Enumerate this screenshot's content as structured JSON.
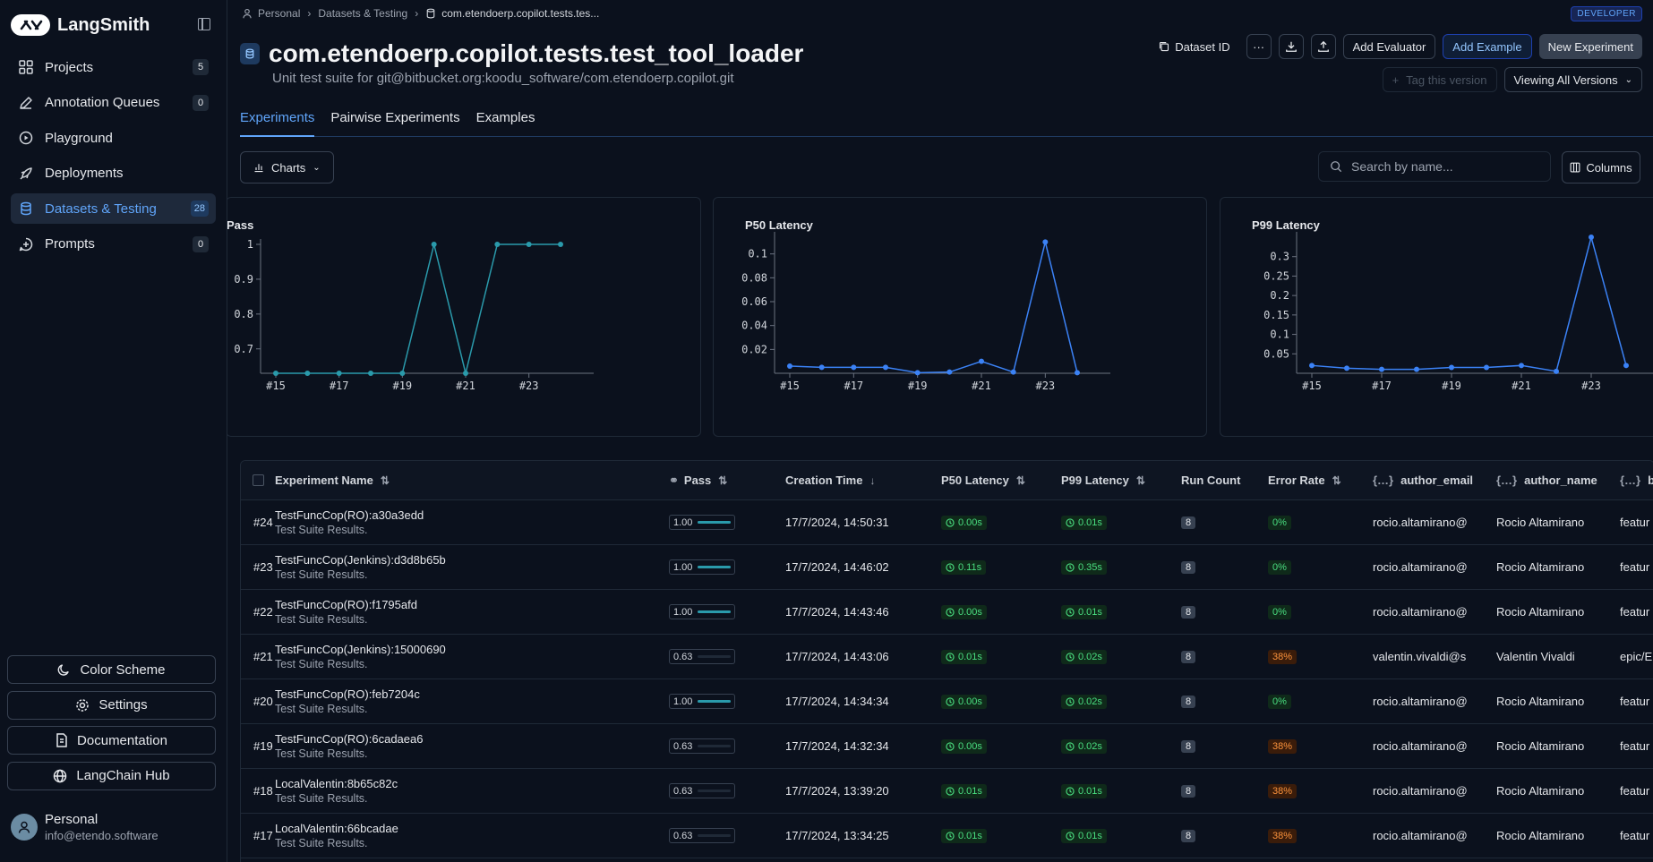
{
  "sidebar": {
    "brand": "LangSmith",
    "items": [
      {
        "label": "Projects",
        "count": "5",
        "icon": "grid-icon"
      },
      {
        "label": "Annotation Queues",
        "count": "0",
        "icon": "pen-icon"
      },
      {
        "label": "Playground",
        "count": "",
        "icon": "play-icon"
      },
      {
        "label": "Deployments",
        "count": "",
        "icon": "rocket-icon"
      },
      {
        "label": "Datasets & Testing",
        "count": "28",
        "icon": "database-icon",
        "active": true
      },
      {
        "label": "Prompts",
        "count": "0",
        "icon": "prompt-icon"
      }
    ],
    "bottom": {
      "color_scheme": "Color Scheme",
      "settings": "Settings",
      "documentation": "Documentation",
      "hub": "LangChain Hub"
    },
    "user": {
      "name": "Personal",
      "email": "info@etendo.software"
    }
  },
  "breadcrumb": {
    "root": "Personal",
    "section": "Datasets & Testing",
    "current": "com.etendoerp.copilot.tests.tes..."
  },
  "dev_badge": "DEVELOPER",
  "header": {
    "title": "com.etendoerp.copilot.tests.test_tool_loader",
    "subtitle": "Unit test suite for git@bitbucket.org:koodu_software/com.etendoerp.copilot.git",
    "dataset_id": "Dataset ID",
    "more": "···",
    "add_evaluator": "Add Evaluator",
    "add_example": "Add Example",
    "new_experiment": "New Experiment",
    "tag_version": "Tag this version",
    "viewing": "Viewing All Versions"
  },
  "tabs": [
    "Experiments",
    "Pairwise Experiments",
    "Examples"
  ],
  "toolbar": {
    "charts": "Charts",
    "search_placeholder": "Search by name...",
    "columns": "Columns"
  },
  "chart_data": [
    {
      "type": "line",
      "title": "Pass",
      "x": [
        "#15",
        "#16",
        "#17",
        "#18",
        "#19",
        "#20",
        "#21",
        "#22",
        "#23",
        "#24"
      ],
      "values": [
        0.63,
        0.63,
        0.63,
        0.63,
        0.63,
        1.0,
        0.63,
        1.0,
        1.0,
        1.0
      ],
      "yticks": [
        "1",
        "0.9",
        "0.8",
        "0.7"
      ],
      "xticks": [
        "#15",
        "#17",
        "#19",
        "#21",
        "#23"
      ],
      "ylim": [
        0.63,
        1.0
      ],
      "color": "#2a9aab"
    },
    {
      "type": "line",
      "title": "P50 Latency",
      "x": [
        "#15",
        "#16",
        "#17",
        "#18",
        "#19",
        "#20",
        "#21",
        "#22",
        "#23",
        "#24"
      ],
      "values": [
        0.006,
        0.005,
        0.005,
        0.005,
        0.0005,
        0.001,
        0.01,
        0.001,
        0.11,
        0.0005
      ],
      "yticks": [
        "0.1",
        "0.08",
        "0.06",
        "0.04",
        "0.02"
      ],
      "xticks": [
        "#15",
        "#17",
        "#19",
        "#21",
        "#23"
      ],
      "ylim": [
        0,
        0.114
      ],
      "color": "#3b82f6"
    },
    {
      "type": "line",
      "title": "P99 Latency",
      "x": [
        "#15",
        "#16",
        "#17",
        "#18",
        "#19",
        "#20",
        "#21",
        "#22",
        "#23",
        "#24"
      ],
      "values": [
        0.02,
        0.013,
        0.01,
        0.01,
        0.015,
        0.015,
        0.02,
        0.005,
        0.35,
        0.02
      ],
      "yticks": [
        "0.3",
        "0.25",
        "0.2",
        "0.15",
        "0.1",
        "0.05"
      ],
      "xticks": [
        "#15",
        "#17",
        "#19",
        "#21",
        "#23"
      ],
      "ylim": [
        0,
        0.35
      ],
      "color": "#3b82f6"
    }
  ],
  "table": {
    "headers": {
      "name": "Experiment Name",
      "pass": "Pass",
      "time": "Creation Time",
      "p50": "P50 Latency",
      "p99": "P99 Latency",
      "run": "Run Count",
      "err": "Error Rate",
      "mail": "author_email",
      "auth": "author_name",
      "b": "b"
    },
    "rows": [
      {
        "num": "#24",
        "name": "TestFuncCop(RO):a30a3edd",
        "desc": "Test Suite Results.",
        "pass": "1.00",
        "pass_frac": 1.0,
        "time": "17/7/2024, 14:50:31",
        "p50": "0.00s",
        "p99": "0.01s",
        "run": "8",
        "err": "0%",
        "err_bad": false,
        "mail": "rocio.altamirano@",
        "auth": "Rocio Altamirano",
        "b": "featur"
      },
      {
        "num": "#23",
        "name": "TestFuncCop(Jenkins):d3d8b65b",
        "desc": "Test Suite Results.",
        "pass": "1.00",
        "pass_frac": 1.0,
        "time": "17/7/2024, 14:46:02",
        "p50": "0.11s",
        "p99": "0.35s",
        "run": "8",
        "err": "0%",
        "err_bad": false,
        "mail": "rocio.altamirano@",
        "auth": "Rocio Altamirano",
        "b": "featur"
      },
      {
        "num": "#22",
        "name": "TestFuncCop(RO):f1795afd",
        "desc": "Test Suite Results.",
        "pass": "1.00",
        "pass_frac": 1.0,
        "time": "17/7/2024, 14:43:46",
        "p50": "0.00s",
        "p99": "0.01s",
        "run": "8",
        "err": "0%",
        "err_bad": false,
        "mail": "rocio.altamirano@",
        "auth": "Rocio Altamirano",
        "b": "featur"
      },
      {
        "num": "#21",
        "name": "TestFuncCop(Jenkins):15000690",
        "desc": "Test Suite Results.",
        "pass": "0.63",
        "pass_frac": 0.0,
        "time": "17/7/2024, 14:43:06",
        "p50": "0.01s",
        "p99": "0.02s",
        "run": "8",
        "err": "38%",
        "err_bad": true,
        "mail": "valentin.vivaldi@s",
        "auth": "Valentin Vivaldi",
        "b": "epic/E"
      },
      {
        "num": "#20",
        "name": "TestFuncCop(RO):feb7204c",
        "desc": "Test Suite Results.",
        "pass": "1.00",
        "pass_frac": 1.0,
        "time": "17/7/2024, 14:34:34",
        "p50": "0.00s",
        "p99": "0.02s",
        "run": "8",
        "err": "0%",
        "err_bad": false,
        "mail": "rocio.altamirano@",
        "auth": "Rocio Altamirano",
        "b": "featur"
      },
      {
        "num": "#19",
        "name": "TestFuncCop(RO):6cadaea6",
        "desc": "Test Suite Results.",
        "pass": "0.63",
        "pass_frac": 0.0,
        "time": "17/7/2024, 14:32:34",
        "p50": "0.00s",
        "p99": "0.02s",
        "run": "8",
        "err": "38%",
        "err_bad": true,
        "mail": "rocio.altamirano@",
        "auth": "Rocio Altamirano",
        "b": "featur"
      },
      {
        "num": "#18",
        "name": "LocalValentin:8b65c82c",
        "desc": "Test Suite Results.",
        "pass": "0.63",
        "pass_frac": 0.0,
        "time": "17/7/2024, 13:39:20",
        "p50": "0.01s",
        "p99": "0.01s",
        "run": "8",
        "err": "38%",
        "err_bad": true,
        "mail": "rocio.altamirano@",
        "auth": "Rocio Altamirano",
        "b": "featur"
      },
      {
        "num": "#17",
        "name": "LocalValentin:66bcadae",
        "desc": "Test Suite Results.",
        "pass": "0.63",
        "pass_frac": 0.0,
        "time": "17/7/2024, 13:34:25",
        "p50": "0.01s",
        "p99": "0.01s",
        "run": "8",
        "err": "38%",
        "err_bad": true,
        "mail": "rocio.altamirano@",
        "auth": "Rocio Altamirano",
        "b": "featur"
      }
    ]
  }
}
